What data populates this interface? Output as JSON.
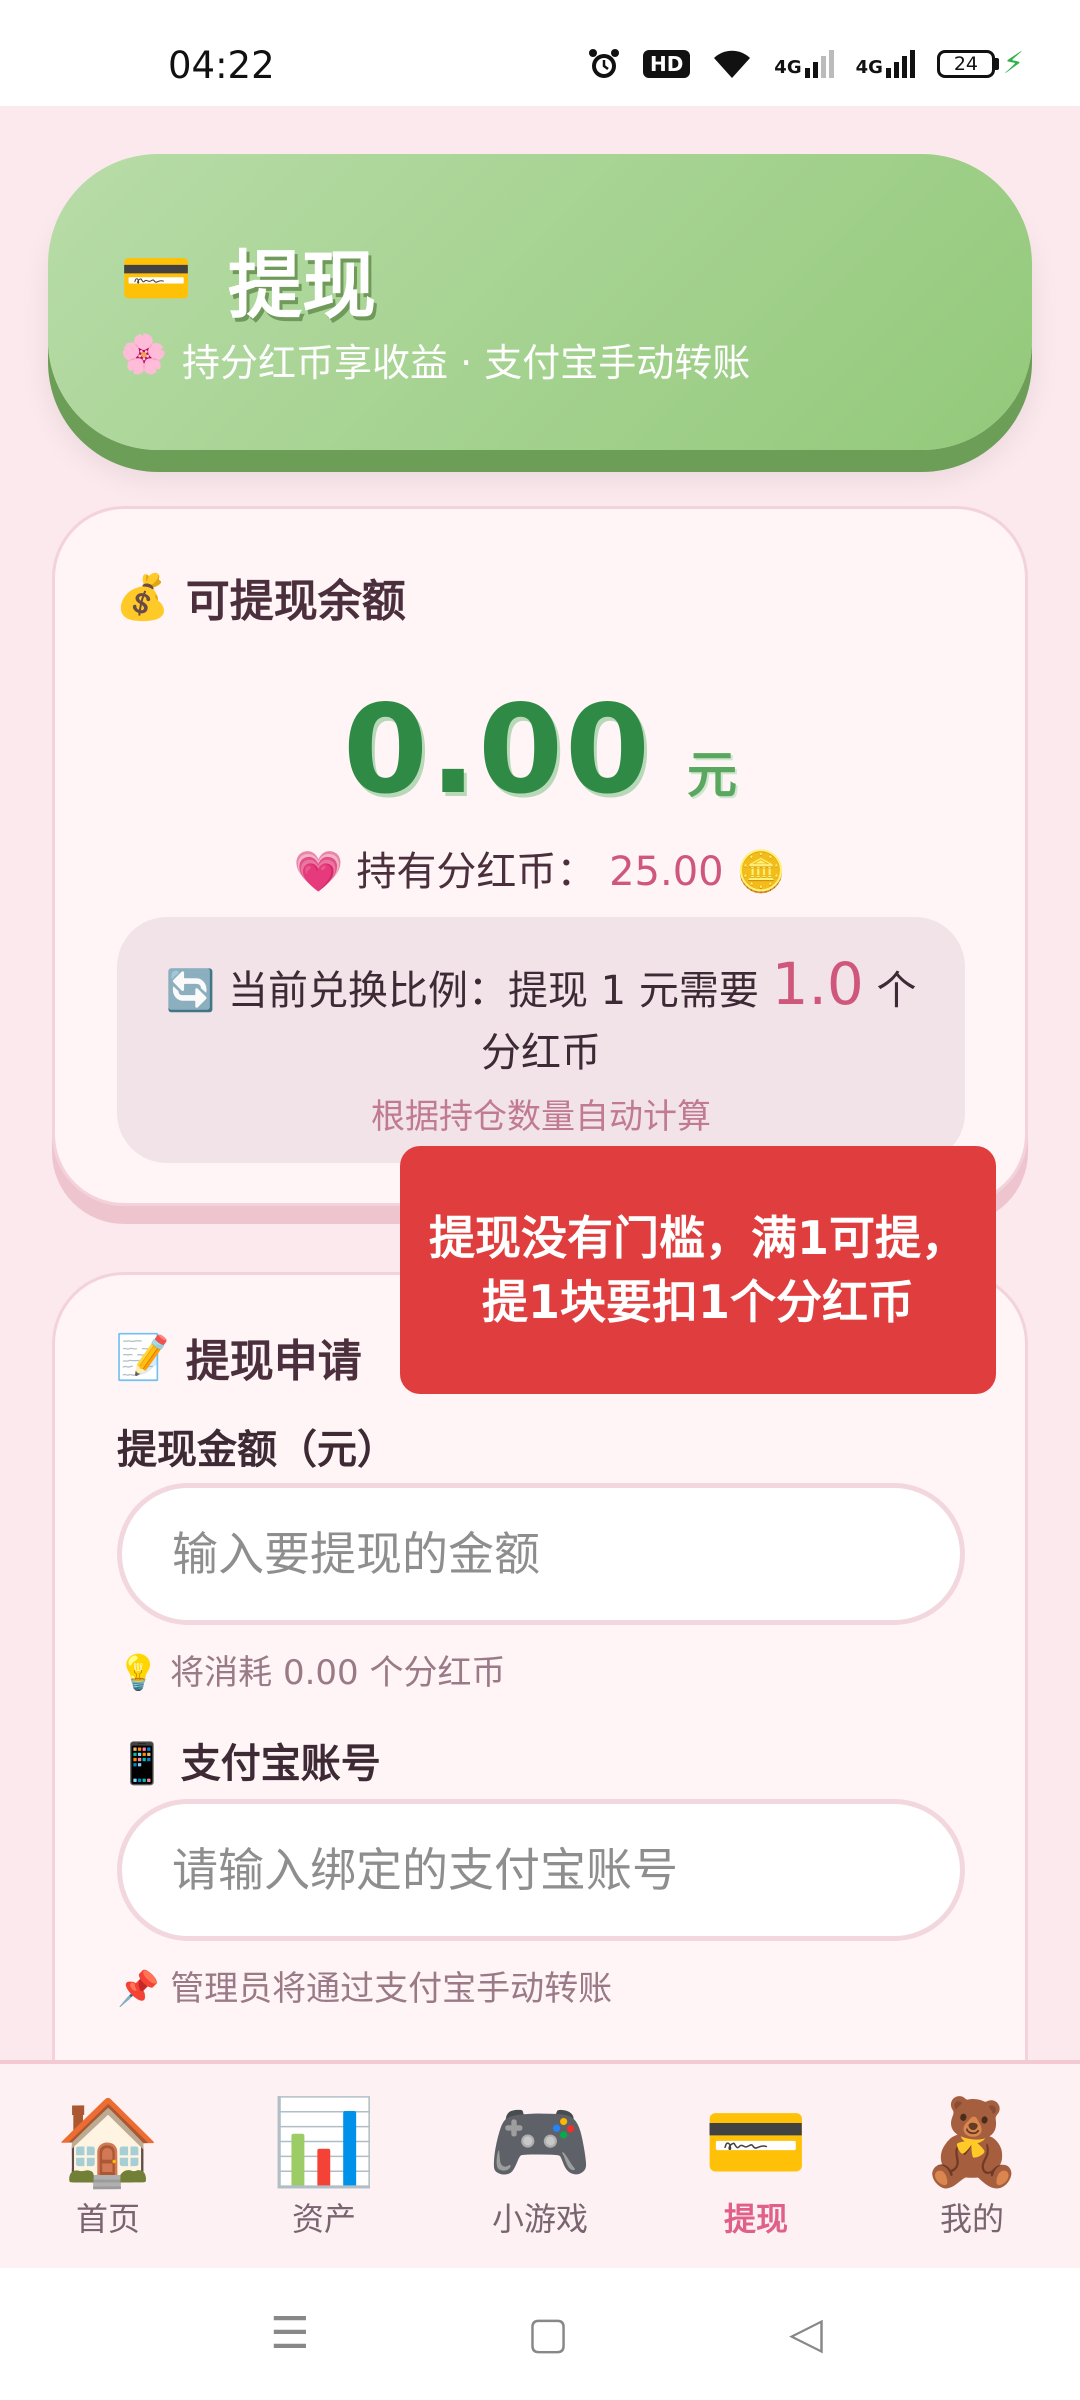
{
  "status_bar": {
    "time": "04:22",
    "hd": "HD",
    "net1": "4G",
    "net2": "4G",
    "battery": "24"
  },
  "hero": {
    "icon": "💳",
    "title": "提现",
    "sub_icon": "🌸",
    "subtitle": "持分红币享收益 · 支付宝手动转账"
  },
  "balance_card": {
    "icon": "💰",
    "title": "可提现余额",
    "amount": "0.00",
    "unit": "元",
    "hold_icon": "💗",
    "hold_label": "持有分红币：",
    "hold_value": "25.00",
    "coin_icon": "🪙",
    "ratio_icon": "🔄",
    "ratio_prefix": "当前兑换比例：提现 1 元需要",
    "ratio_value": "1.0",
    "ratio_suffix": "个分红币",
    "ratio_note": "根据持仓数量自动计算"
  },
  "apply_card": {
    "icon": "📝",
    "title": "提现申请",
    "amount_label": "提现金额（元）",
    "amount_placeholder": "输入要提现的金额",
    "consume_icon": "💡",
    "consume_hint": "将消耗 0.00 个分红币",
    "account_icon": "📱",
    "account_label": "支付宝账号",
    "account_placeholder": "请输入绑定的支付宝账号",
    "admin_icon": "📌",
    "admin_hint": "管理员将通过支付宝手动转账"
  },
  "toast": {
    "text": "提现没有门槛，满1可提，提1块要扣1个分红币"
  },
  "bottom_nav": [
    {
      "icon": "🏠",
      "label": "首页",
      "active": false
    },
    {
      "icon": "📊",
      "label": "资产",
      "active": false
    },
    {
      "icon": "🎮",
      "label": "小游戏",
      "active": false
    },
    {
      "icon": "💳",
      "label": "提现",
      "active": true
    },
    {
      "icon": "🧸",
      "label": "我的",
      "active": false
    }
  ],
  "system_nav": {
    "menu": "☰",
    "home": "▢",
    "back": "◁"
  }
}
